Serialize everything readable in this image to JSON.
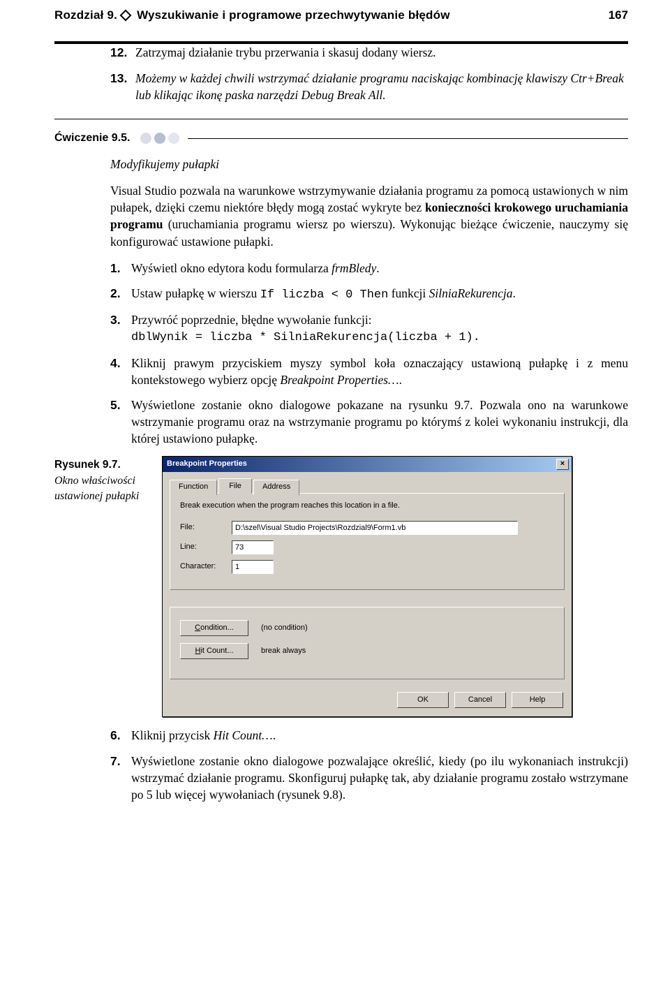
{
  "header": {
    "chapter_prefix": "Rozdział 9.",
    "chapter_title": "Wyszukiwanie i programowe przechwytywanie błędów",
    "page_number": "167"
  },
  "intro_list": {
    "items": [
      {
        "num": "12.",
        "text_a": "Zatrzymaj działanie trybu przerwania i skasuj dodany wiersz."
      },
      {
        "num": "13.",
        "text_a": "Możemy w każdej chwili wstrzymać działanie programu naciskając kombinację klawiszy Ctr+Break lub klikając ikonę paska narzędzi Debug Break All."
      }
    ]
  },
  "exercise": {
    "label": "Ćwiczenie 9.5."
  },
  "subheading": "Modyfikujemy pułapki",
  "para_main_a": "Visual Studio pozwala na warunkowe wstrzymywanie działania programu za pomocą ustawionych w nim pułapek, dzięki czemu niektóre błędy mogą zostać wykryte bez ",
  "para_main_bold": "konieczności krokowego uruchamiania programu",
  "para_main_b": " (uruchamiania programu wiersz po wierszu). Wykonując bieżące ćwiczenie, nauczymy się konfigurować ustawione pułapki.",
  "steps": {
    "items": [
      {
        "num": "1.",
        "html_parts": [
          {
            "t": "plain",
            "v": "Wyświetl okno edytora kodu formularza "
          },
          {
            "t": "italic",
            "v": "frmBledy"
          },
          {
            "t": "plain",
            "v": "."
          }
        ]
      },
      {
        "num": "2.",
        "html_parts": [
          {
            "t": "plain",
            "v": "Ustaw pułapkę w wierszu "
          },
          {
            "t": "mono",
            "v": "If liczba < 0 Then"
          },
          {
            "t": "plain",
            "v": " funkcji "
          },
          {
            "t": "italic",
            "v": "SilniaRekurencja"
          },
          {
            "t": "plain",
            "v": "."
          }
        ]
      },
      {
        "num": "3.",
        "html_parts": [
          {
            "t": "plain",
            "v": "Przywróć poprzednie, błędne wywołanie funkcji:"
          },
          {
            "t": "monoBlock",
            "v": "dblWynik = liczba * SilniaRekurencja(liczba + 1)."
          }
        ]
      },
      {
        "num": "4.",
        "html_parts": [
          {
            "t": "plain",
            "v": "Kliknij prawym przyciskiem myszy symbol koła oznaczający ustawioną pułapkę i z menu kontekstowego wybierz opcję "
          },
          {
            "t": "italic",
            "v": "Breakpoint Properties…"
          },
          {
            "t": "plain",
            "v": "."
          }
        ]
      },
      {
        "num": "5.",
        "html_parts": [
          {
            "t": "plain",
            "v": "Wyświetlone zostanie okno dialogowe pokazane na rysunku 9.7. Pozwala ono na warunkowe wstrzymanie programu oraz na wstrzymanie programu po którymś z kolei wykonaniu instrukcji, dla której ustawiono pułapkę."
          }
        ]
      }
    ]
  },
  "figure": {
    "label": "Rysunek 9.7.",
    "desc": "Okno właściwości ustawionej pułapki"
  },
  "dialog": {
    "title": "Breakpoint Properties",
    "tabs": {
      "function": "Function",
      "file": "File",
      "address": "Address"
    },
    "panel_text": "Break execution when the program reaches this location in a file.",
    "file_label": "File:",
    "file_value": "D:\\szel\\Visual Studio Projects\\Rozdzial9\\Form1.vb",
    "line_label": "Line:",
    "line_value": "73",
    "char_label": "Character:",
    "char_value": "1",
    "condition_btn_pre": "C",
    "condition_btn_post": "ondition...",
    "condition_text": "(no condition)",
    "hitcount_btn_pre": "H",
    "hitcount_btn_post": "it Count...",
    "hitcount_text": "break always",
    "ok": "OK",
    "cancel": "Cancel",
    "help": "Help"
  },
  "steps2": {
    "items": [
      {
        "num": "6.",
        "html_parts": [
          {
            "t": "plain",
            "v": "Kliknij przycisk "
          },
          {
            "t": "italic",
            "v": "Hit Count…"
          },
          {
            "t": "plain",
            "v": "."
          }
        ]
      },
      {
        "num": "7.",
        "html_parts": [
          {
            "t": "plain",
            "v": "Wyświetlone zostanie okno dialogowe pozwalające określić, kiedy (po ilu wykonaniach instrukcji) wstrzymać działanie programu. Skonfiguruj pułapkę tak, aby działanie programu zostało wstrzymane po 5 lub więcej wywołaniach (rysunek 9.8)."
          }
        ]
      }
    ]
  }
}
